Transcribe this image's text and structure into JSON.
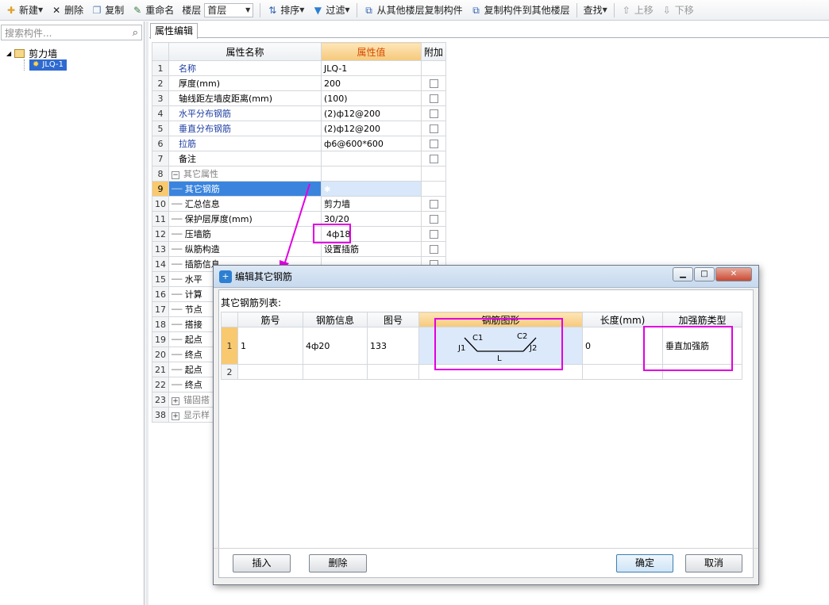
{
  "toolbar": {
    "new_label": "新建",
    "delete_label": "删除",
    "copy_label": "复制",
    "rename_label": "重命名",
    "floor_label": "楼层",
    "floor_value": "首层",
    "sort_label": "排序",
    "filter_label": "过滤",
    "copy_from_label": "从其他楼层复制构件",
    "copy_to_label": "复制构件到其他楼层",
    "find_label": "查找",
    "move_up_label": "上移",
    "move_down_label": "下移"
  },
  "search": {
    "placeholder": "搜索构件..."
  },
  "tree": {
    "root": "剪力墙",
    "child": "JLQ-1"
  },
  "tab": {
    "label": "属性编辑"
  },
  "props": {
    "headers": [
      "属性名称",
      "属性值",
      "附加"
    ],
    "rows": [
      {
        "n": "1",
        "name": "名称",
        "value": "JLQ-1"
      },
      {
        "n": "2",
        "name": "厚度(mm)",
        "value": "200"
      },
      {
        "n": "3",
        "name": "轴线距左墙皮距离(mm)",
        "value": "(100)"
      },
      {
        "n": "4",
        "name": "水平分布钢筋",
        "value": "(2)ф12@200"
      },
      {
        "n": "5",
        "name": "垂直分布钢筋",
        "value": "(2)ф12@200"
      },
      {
        "n": "6",
        "name": "拉筋",
        "value": "ф6@600*600"
      },
      {
        "n": "7",
        "name": "备注",
        "value": ""
      },
      {
        "n": "8",
        "name": "其它属性",
        "value": ""
      },
      {
        "n": "9",
        "name": "其它钢筋",
        "value": ""
      },
      {
        "n": "10",
        "name": "汇总信息",
        "value": "剪力墙"
      },
      {
        "n": "11",
        "name": "保护层厚度(mm)",
        "value": "30/20"
      },
      {
        "n": "12",
        "name": "压墙筋",
        "value": "4ф18"
      },
      {
        "n": "13",
        "name": "纵筋构造",
        "value": "设置插筋"
      },
      {
        "n": "14",
        "name": "插筋信息",
        "value": ""
      },
      {
        "n": "15",
        "name": "水平",
        "value": ""
      },
      {
        "n": "16",
        "name": "计算",
        "value": ""
      },
      {
        "n": "17",
        "name": "节点",
        "value": ""
      },
      {
        "n": "18",
        "name": "搭接",
        "value": ""
      },
      {
        "n": "19",
        "name": "起点",
        "value": ""
      },
      {
        "n": "20",
        "name": "终点",
        "value": ""
      },
      {
        "n": "21",
        "name": "起点",
        "value": ""
      },
      {
        "n": "22",
        "name": "终点",
        "value": ""
      },
      {
        "n": "23",
        "name": "锚固搭",
        "value": ""
      },
      {
        "n": "38",
        "name": "显示样",
        "value": ""
      }
    ]
  },
  "dialog": {
    "title": "编辑其它钢筋",
    "list_label": "其它钢筋列表:",
    "headers": [
      "筋号",
      "钢筋信息",
      "图号",
      "钢筋图形",
      "长度(mm)",
      "加强筋类型"
    ],
    "row1": {
      "n": "1",
      "bar_no": "1",
      "info": "4ф20",
      "fig_no": "133",
      "length": "0",
      "type": "垂直加强筋"
    },
    "row2": {
      "n": "2"
    },
    "shape": {
      "c1": "C1",
      "c2": "C2",
      "j1": "J1",
      "j2": "J2",
      "l": "L"
    },
    "insert_label": "插入",
    "delete_label": "删除",
    "ok_label": "确定",
    "cancel_label": "取消"
  },
  "colors": {
    "annotation": "#e100e1",
    "selection": "#3a84de",
    "header_active": "#f6c87a"
  }
}
